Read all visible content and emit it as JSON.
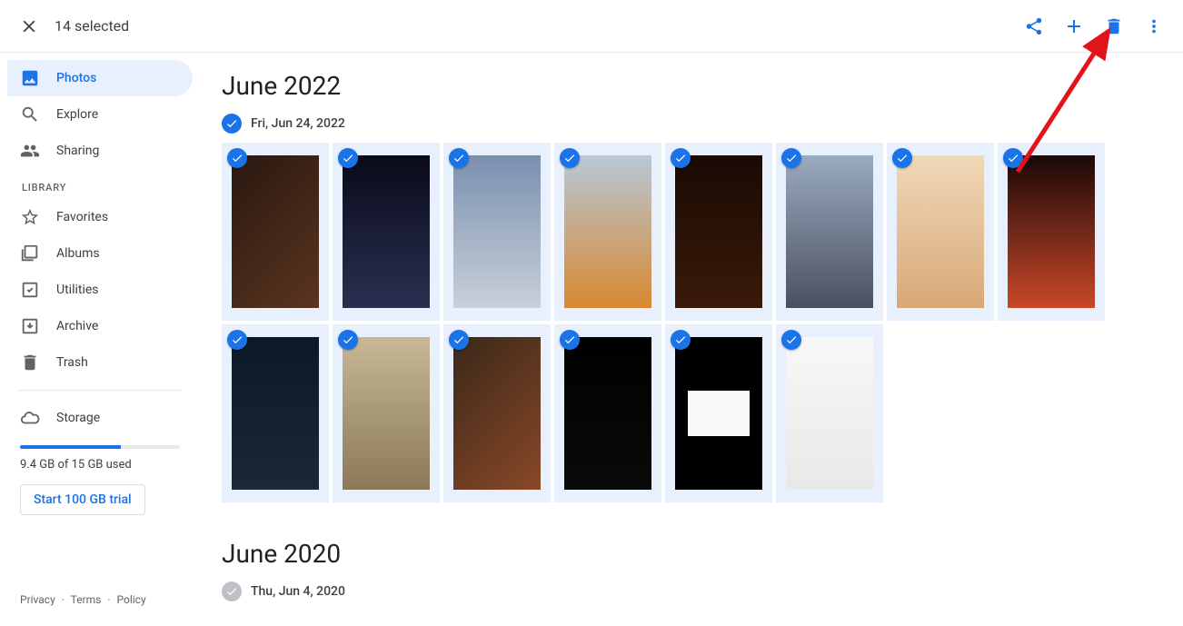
{
  "topbar": {
    "selection_text": "14 selected"
  },
  "sidebar": {
    "nav": [
      {
        "label": "Photos",
        "icon": "photo-icon",
        "active": true
      },
      {
        "label": "Explore",
        "icon": "search-icon",
        "active": false
      },
      {
        "label": "Sharing",
        "icon": "sharing-icon",
        "active": false
      }
    ],
    "library_label": "LIBRARY",
    "library": [
      {
        "label": "Favorites",
        "icon": "star-icon"
      },
      {
        "label": "Albums",
        "icon": "album-icon"
      },
      {
        "label": "Utilities",
        "icon": "utilities-icon"
      },
      {
        "label": "Archive",
        "icon": "archive-icon"
      },
      {
        "label": "Trash",
        "icon": "trash-icon"
      }
    ],
    "storage": {
      "label": "Storage",
      "used_text": "9.4 GB of 15 GB used",
      "percent": 63,
      "trial_text": "Start 100 GB trial"
    },
    "footer": {
      "privacy": "Privacy",
      "terms": "Terms",
      "policy": "Policy"
    }
  },
  "sections": [
    {
      "month": "June 2022",
      "groups": [
        {
          "date": "Fri, Jun 24, 2022",
          "all_selected": true,
          "photos": [
            {
              "bg": "linear-gradient(135deg,#2a1810,#5a3520)"
            },
            {
              "bg": "linear-gradient(180deg,#0a0a1a,#2a3050)"
            },
            {
              "bg": "linear-gradient(180deg,#7a90b0,#c8d0d8)"
            },
            {
              "bg": "linear-gradient(180deg,#b8c8d8,#d88830)"
            },
            {
              "bg": "linear-gradient(180deg,#1a0a05,#3a1a08)"
            },
            {
              "bg": "linear-gradient(180deg,#9aaac0,#4a5060)"
            },
            {
              "bg": "linear-gradient(180deg,#f0d8b8,#d8a878)"
            },
            {
              "bg": "linear-gradient(180deg,#1a0808,#c84828)"
            },
            {
              "bg": "linear-gradient(180deg,#0a1828,#1a2838)"
            },
            {
              "bg": "linear-gradient(180deg,#c8b898,#8a7858)"
            },
            {
              "bg": "linear-gradient(135deg,#3a2818,#8a4828)"
            },
            {
              "bg": "linear-gradient(180deg,#000,#0a0a0a)"
            },
            {
              "bg": "linear-gradient(180deg,#000,#000)",
              "inset": "#fafafa"
            },
            {
              "bg": "linear-gradient(180deg,#f8f8f8,#e8e8e8)"
            }
          ]
        }
      ]
    },
    {
      "month": "June 2020",
      "groups": [
        {
          "date": "Thu, Jun 4, 2020",
          "all_selected": false,
          "photos": []
        }
      ]
    }
  ]
}
